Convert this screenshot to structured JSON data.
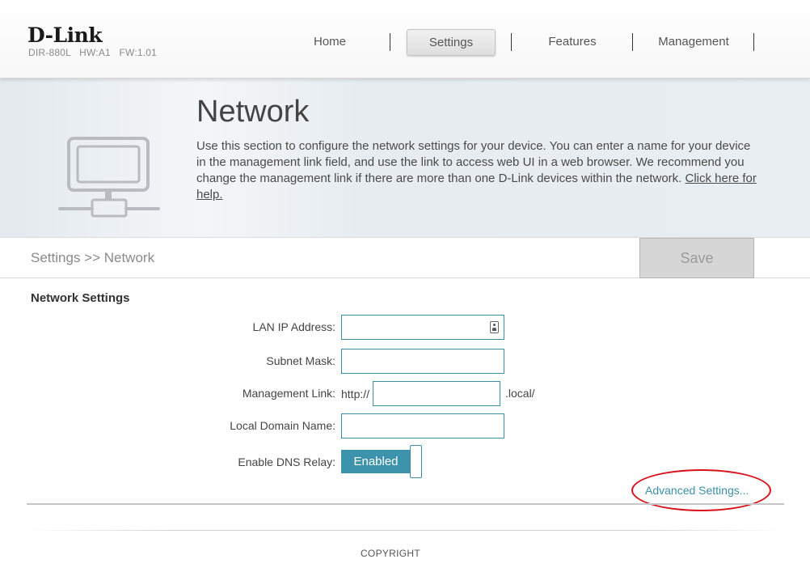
{
  "header": {
    "logo": "D-Link",
    "device_info": "DIR-880L   HW:A1   FW:1.01",
    "nav": [
      "Home",
      "Settings",
      "Features",
      "Management"
    ],
    "active_nav": "Settings"
  },
  "banner": {
    "title": "Network",
    "description": "Use this section to configure the network settings for your device. You can enter a name for your device in the management link field, and use the link to access web UI in a web browser. We recommend you change the management link if there are more than one D-Link devices within the network.",
    "help_link": "Click here for help.",
    "icon": "computer-network-icon"
  },
  "breadcrumb": "Settings >> Network",
  "save_label": "Save",
  "form": {
    "section_title": "Network Settings",
    "lan_ip_label": "LAN IP Address:",
    "lan_ip_value": "",
    "subnet_label": "Subnet Mask:",
    "subnet_value": "",
    "mgmt_label": "Management Link:",
    "mgmt_prefix": "http://",
    "mgmt_value": "",
    "mgmt_suffix": ".local/",
    "domain_label": "Local Domain Name:",
    "domain_value": "",
    "dns_label": "Enable DNS Relay:",
    "dns_toggle": "Enabled",
    "advanced_link": "Advanced Settings..."
  },
  "colors": {
    "accent": "#3d93ab",
    "highlight_circle": "#d9101a"
  },
  "footer": {
    "copyright": "COPYRIGHT"
  }
}
